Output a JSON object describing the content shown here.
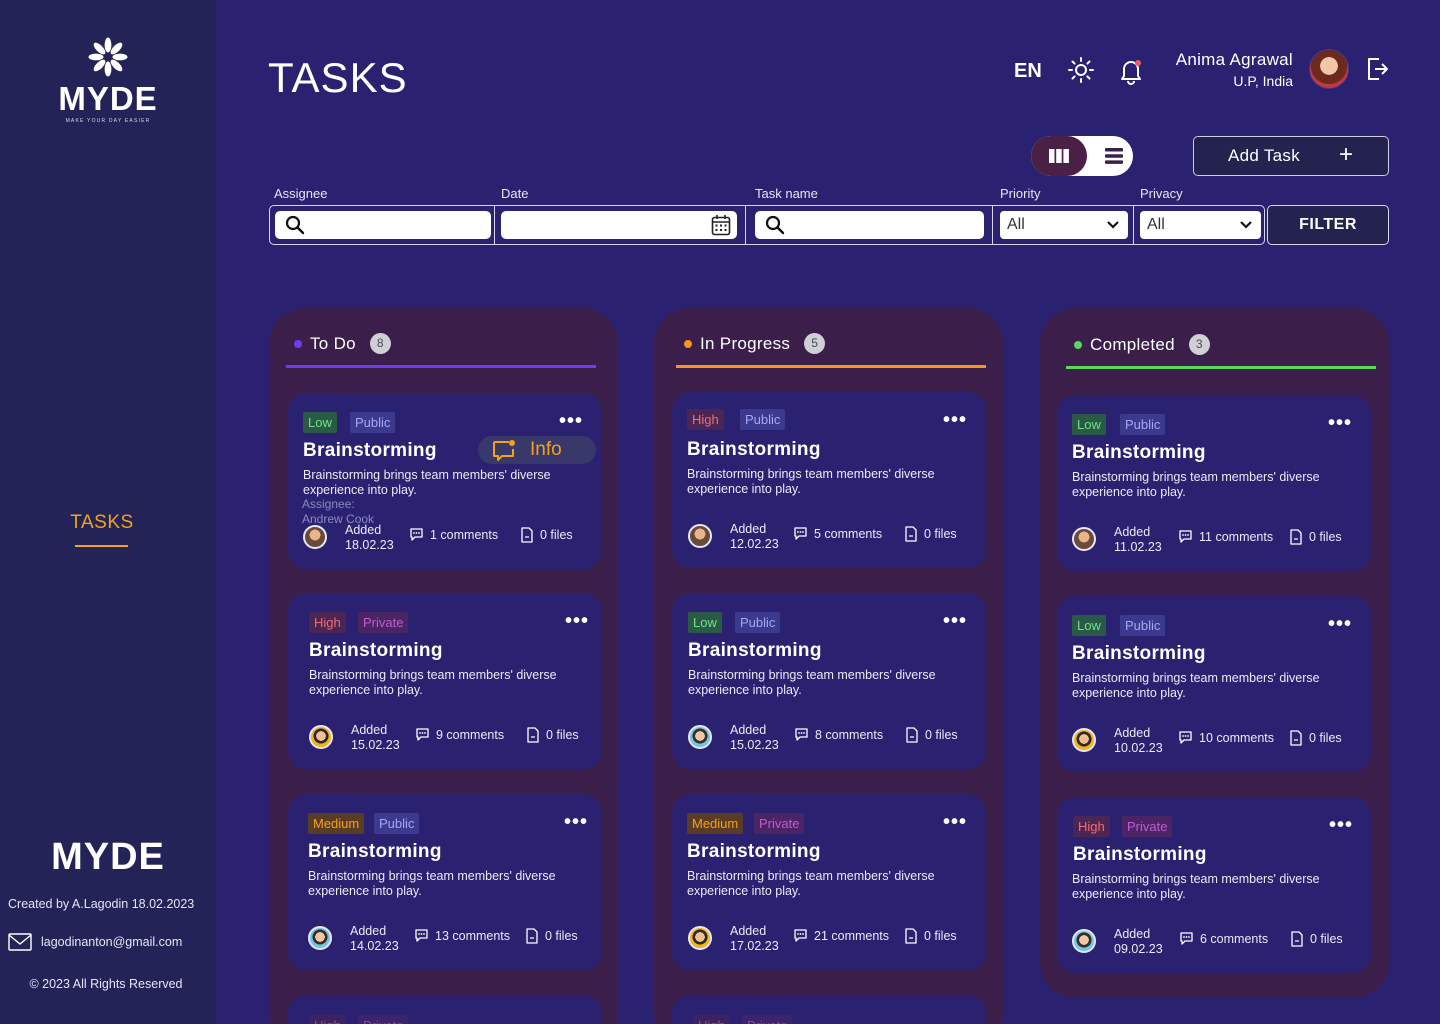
{
  "sidebar": {
    "brand": "MYDE",
    "tagline": "MAKE YOUR DAY EASIER",
    "nav_tasks": "TASKS",
    "footer_brand": "MYDE",
    "created": "Created by A.Lagodin 18.02.2023",
    "email": "lagodinanton@gmail.com",
    "copyright": "© 2023 All Rights Reserved"
  },
  "header": {
    "title": "TASKS",
    "lang": "EN",
    "user_name": "Anima Agrawal",
    "user_location": "U.P, India"
  },
  "toolbar": {
    "add_task": "Add Task",
    "add_icon": "+"
  },
  "filters": {
    "assignee_label": "Assignee",
    "date_label": "Date",
    "task_name_label": "Task name",
    "priority_label": "Priority",
    "priority_value": "All",
    "privacy_label": "Privacy",
    "privacy_value": "All",
    "filter_button": "FILTER"
  },
  "colors": {
    "background": "#2a2270",
    "sidebar": "#232357",
    "column": "#3b1f4a",
    "accent_orange": "#f2a31b",
    "todo": "#6a3ff0",
    "in_progress": "#f7941d",
    "completed": "#5ad85a"
  },
  "columns": [
    {
      "title": "To Do",
      "count": "8",
      "cards": [
        {
          "priority": "Low",
          "privacy": "Public",
          "title": "Brainstorming",
          "description": "Brainstorming brings team members' diverse experience into play.",
          "assignee_label": "Assignee:",
          "assignee_name": "Andrew Cook",
          "added_label": "Added",
          "date": "18.02.23",
          "comments": "1 comments",
          "files": "0 files",
          "info_label": "Info"
        },
        {
          "priority": "High",
          "privacy": "Private",
          "title": "Brainstorming",
          "description": "Brainstorming brings team members' diverse experience into play.",
          "added_label": "Added",
          "date": "15.02.23",
          "comments": "9 comments",
          "files": "0 files"
        },
        {
          "priority": "Medium",
          "privacy": "Public",
          "title": "Brainstorming",
          "description": "Brainstorming brings team members' diverse experience into play.",
          "added_label": "Added",
          "date": "14.02.23",
          "comments": "13 comments",
          "files": "0 files"
        }
      ]
    },
    {
      "title": "In Progress",
      "count": "5",
      "cards": [
        {
          "priority": "High",
          "privacy": "Public",
          "title": "Brainstorming",
          "description": "Brainstorming brings team members' diverse experience into play.",
          "added_label": "Added",
          "date": "12.02.23",
          "comments": "5 comments",
          "files": "0 files"
        },
        {
          "priority": "Low",
          "privacy": "Public",
          "title": "Brainstorming",
          "description": "Brainstorming brings team members' diverse experience into play.",
          "added_label": "Added",
          "date": "15.02.23",
          "comments": "8 comments",
          "files": "0 files"
        },
        {
          "priority": "Medium",
          "privacy": "Private",
          "title": "Brainstorming",
          "description": "Brainstorming brings team members' diverse experience into play.",
          "added_label": "Added",
          "date": "17.02.23",
          "comments": "21 comments",
          "files": "0 files"
        }
      ]
    },
    {
      "title": "Completed",
      "count": "3",
      "cards": [
        {
          "priority": "Low",
          "privacy": "Public",
          "title": "Brainstorming",
          "description": "Brainstorming brings team members' diverse experience into play.",
          "added_label": "Added",
          "date": "11.02.23",
          "comments": "11 comments",
          "files": "0 files"
        },
        {
          "priority": "Low",
          "privacy": "Public",
          "title": "Brainstorming",
          "description": "Brainstorming brings team members' diverse experience into play.",
          "added_label": "Added",
          "date": "10.02.23",
          "comments": "10 comments",
          "files": "0 files"
        },
        {
          "priority": "High",
          "privacy": "Private",
          "title": "Brainstorming",
          "description": "Brainstorming brings team members' diverse experience into play.",
          "added_label": "Added",
          "date": "09.02.23",
          "comments": "6 comments",
          "files": "0 files"
        }
      ]
    }
  ],
  "partial_cards": [
    {
      "priority": "High",
      "privacy": "Private"
    },
    {
      "priority": "High",
      "privacy": "Private"
    }
  ]
}
